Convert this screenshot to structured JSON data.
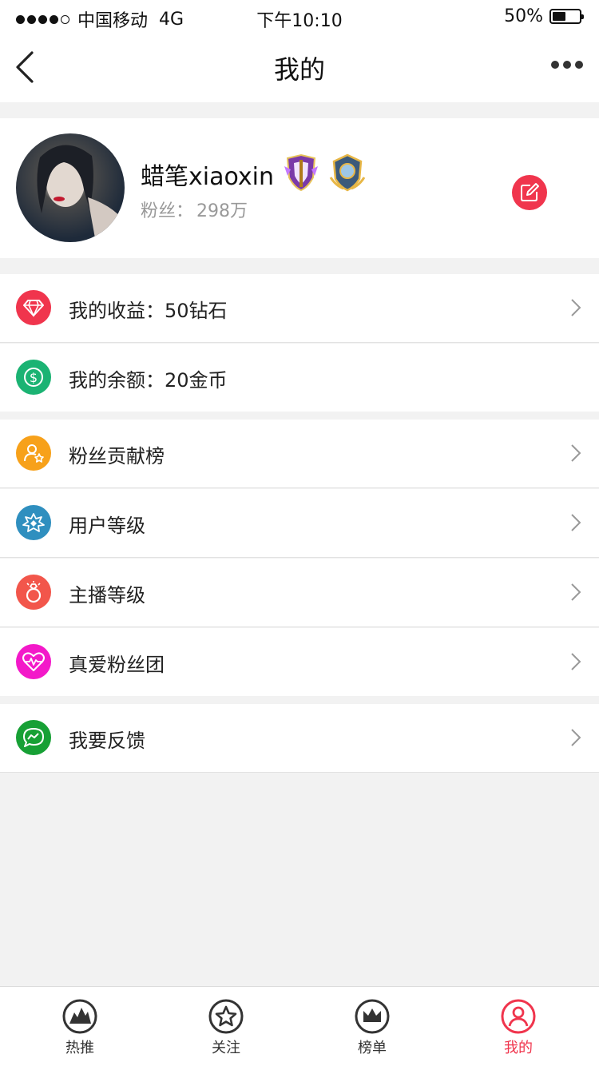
{
  "status_bar": {
    "carrier": "中国移动",
    "network": "4G",
    "time": "下午10:10",
    "battery_percent": "50%",
    "battery_level": 0.5
  },
  "nav": {
    "title": "我的"
  },
  "profile": {
    "username": "蜡笔xiaoxin",
    "fans_label": "粉丝：",
    "fans_count": "298万"
  },
  "menu": {
    "earnings": "我的收益：50钻石",
    "balance": "我的余额：20金币",
    "fan_ranking": "粉丝贡献榜",
    "user_level": "用户等级",
    "host_level": "主播等级",
    "true_love_club": "真爱粉丝团",
    "feedback": "我要反馈"
  },
  "colors": {
    "accent": "#f0354d",
    "diamond": "#f0354d",
    "balance": "#1bb373",
    "fan_ranking": "#f7a11a",
    "user_level": "#2f8fbf",
    "host_level": "#f2564b",
    "true_love_club": "#f319c9",
    "feedback": "#17a035"
  },
  "tabs": [
    {
      "label": "热推",
      "icon": "flame-icon",
      "active": false
    },
    {
      "label": "关注",
      "icon": "star-icon",
      "active": false
    },
    {
      "label": "榜单",
      "icon": "crown-icon",
      "active": false
    },
    {
      "label": "我的",
      "icon": "user-icon",
      "active": true
    }
  ]
}
